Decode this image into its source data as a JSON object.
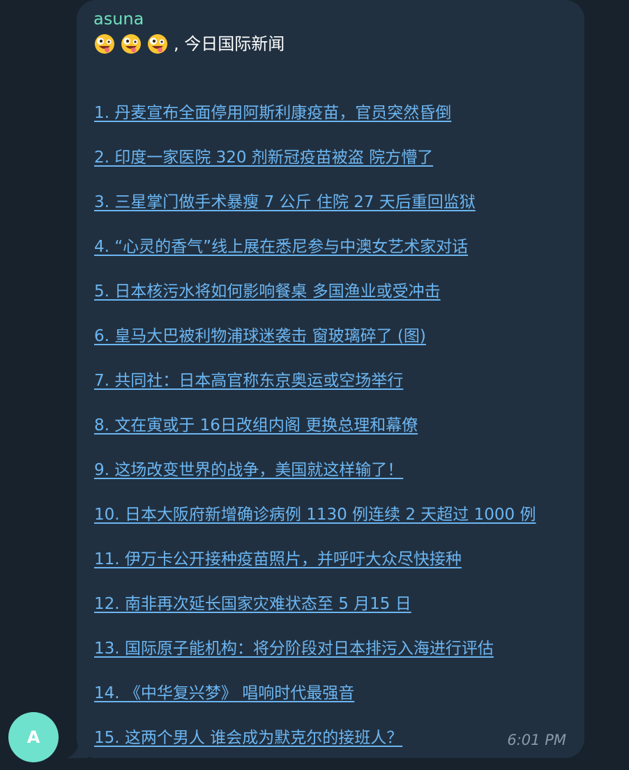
{
  "message": {
    "sender": "asuna",
    "intro_emojis": [
      "zany-face",
      "zany-face",
      "zany-face"
    ],
    "intro_text": ", 今日国际新闻",
    "news": [
      "1. 丹麦宣布全面停用阿斯利康疫苗，官员突然昏倒",
      "2. 印度一家医院 320 剂新冠疫苗被盗 院方懵了",
      "3. 三星掌门做手术暴瘦 7 公斤 住院 27 天后重回监狱",
      "4. “心灵的香气”线上展在悉尼参与中澳女艺术家对话",
      "5. 日本核污水将如何影响餐桌 多国渔业或受冲击",
      "6. 皇马大巴被利物浦球迷袭击 窗玻璃碎了 (图)",
      "7. 共同社：日本高官称东京奥运或空场举行",
      "8. 文在寅或于 16日改组内阁 更换总理和幕僚",
      "9. 这场改变世界的战争，美国就这样输了！",
      "10. 日本大阪府新增确诊病例 1130 例连续 2 天超过 1000 例",
      "11. 伊万卡公开接种疫苗照片，并呼吁大众尽快接种",
      "12. 南非再次延长国家灾难状态至 5 月15 日",
      "13. 国际原子能机构：将分阶段对日本排污入海进行评估",
      "14. 《中华复兴梦》 唱响时代最强音",
      "15. 这两个男人 谁会成为默克尔的接班人？"
    ],
    "time": "6:01 PM"
  },
  "avatar": {
    "initial": "A",
    "color": "#6fe2cd"
  },
  "colors": {
    "background": "#18222d",
    "bubble": "#213040",
    "sender_name": "#6fe0be",
    "link": "#6cb6f2",
    "timestamp": "#8a98a8"
  }
}
